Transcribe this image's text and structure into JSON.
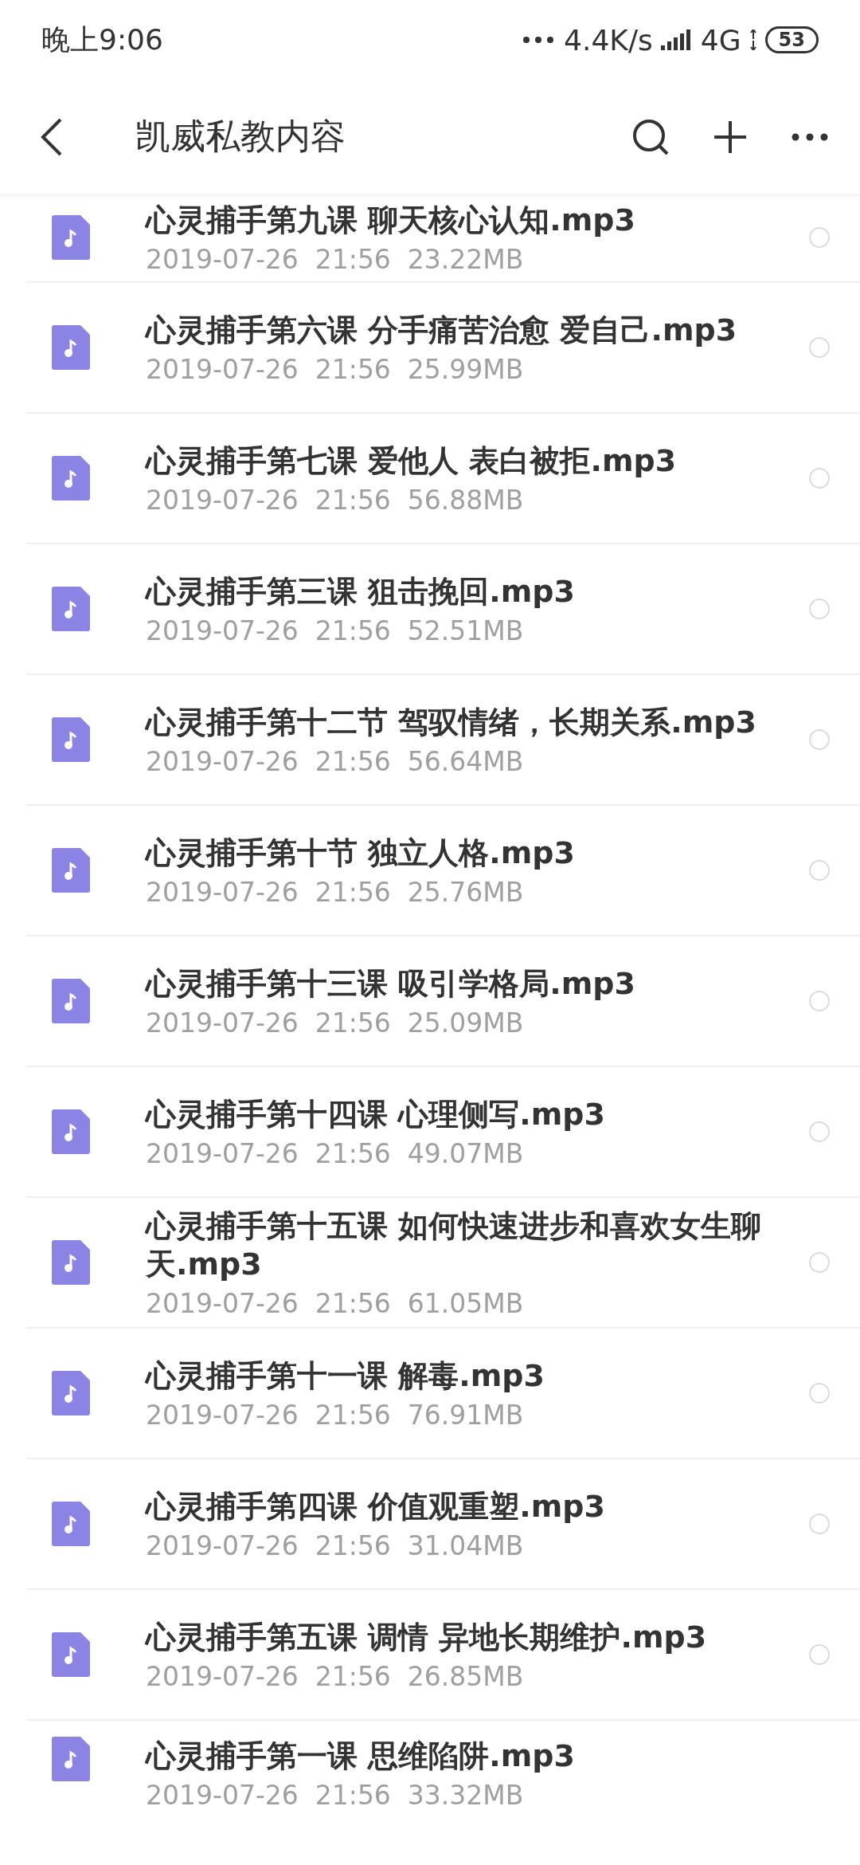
{
  "status_bar": {
    "time": "晚上9:06",
    "network_speed": "4.4K/s",
    "network_type": "4G",
    "battery": "53"
  },
  "header": {
    "title": "凯威私教内容"
  },
  "files": [
    {
      "name": "心灵捕手第九课 聊天核心认知.mp3",
      "date": "2019-07-26",
      "time": "21:56",
      "size": "23.22MB",
      "selected": false
    },
    {
      "name": "心灵捕手第六课 分手痛苦治愈 爱自己.mp3",
      "date": "2019-07-26",
      "time": "21:56",
      "size": "25.99MB",
      "selected": false
    },
    {
      "name": "心灵捕手第七课 爱他人 表白被拒.mp3",
      "date": "2019-07-26",
      "time": "21:56",
      "size": "56.88MB",
      "selected": false
    },
    {
      "name": "心灵捕手第三课 狙击挽回.mp3",
      "date": "2019-07-26",
      "time": "21:56",
      "size": "52.51MB",
      "selected": false
    },
    {
      "name": "心灵捕手第十二节 驾驭情绪，长期关系.mp3",
      "date": "2019-07-26",
      "time": "21:56",
      "size": "56.64MB",
      "selected": false
    },
    {
      "name": "心灵捕手第十节 独立人格.mp3",
      "date": "2019-07-26",
      "time": "21:56",
      "size": "25.76MB",
      "selected": false
    },
    {
      "name": "心灵捕手第十三课 吸引学格局.mp3",
      "date": "2019-07-26",
      "time": "21:56",
      "size": "25.09MB",
      "selected": false
    },
    {
      "name": "心灵捕手第十四课 心理侧写.mp3",
      "date": "2019-07-26",
      "time": "21:56",
      "size": "49.07MB",
      "selected": false
    },
    {
      "name": "心灵捕手第十五课 如何快速进步和喜欢女生聊天.mp3",
      "date": "2019-07-26",
      "time": "21:56",
      "size": "61.05MB",
      "selected": false
    },
    {
      "name": "心灵捕手第十一课 解毒.mp3",
      "date": "2019-07-26",
      "time": "21:56",
      "size": "76.91MB",
      "selected": false
    },
    {
      "name": "心灵捕手第四课 价值观重塑.mp3",
      "date": "2019-07-26",
      "time": "21:56",
      "size": "31.04MB",
      "selected": false
    },
    {
      "name": "心灵捕手第五课 调情 异地长期维护.mp3",
      "date": "2019-07-26",
      "time": "21:56",
      "size": "26.85MB",
      "selected": false
    },
    {
      "name": "心灵捕手第一课 思维陷阱.mp3",
      "date": "2019-07-26",
      "time": "21:56",
      "size": "33.32MB"
    }
  ]
}
